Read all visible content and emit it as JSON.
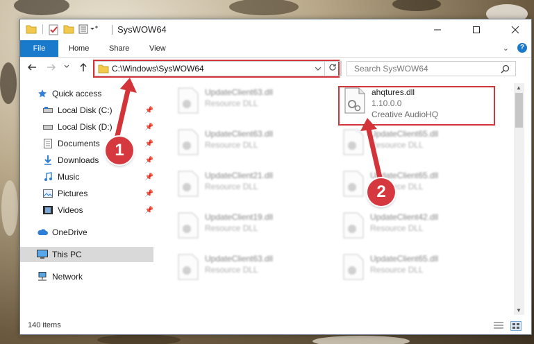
{
  "window": {
    "title": "SysWOW64"
  },
  "ribbon": {
    "tabs": [
      "File",
      "Home",
      "Share",
      "View"
    ]
  },
  "address_bar": {
    "path": "C:\\Windows\\SysWOW64"
  },
  "search": {
    "placeholder": "Search SysWOW64"
  },
  "sidebar": {
    "items": [
      {
        "label": "Quick access",
        "icon": "star-icon"
      },
      {
        "label": "Local Disk (C:)",
        "icon": "drive-icon",
        "pinned": true
      },
      {
        "label": "Local Disk (D:)",
        "icon": "drive-icon",
        "pinned": true
      },
      {
        "label": "Documents",
        "icon": "documents-icon",
        "pinned": true
      },
      {
        "label": "Downloads",
        "icon": "download-icon",
        "pinned": true
      },
      {
        "label": "Music",
        "icon": "music-icon",
        "pinned": true
      },
      {
        "label": "Pictures",
        "icon": "pictures-icon",
        "pinned": true
      },
      {
        "label": "Videos",
        "icon": "videos-icon",
        "pinned": true
      },
      {
        "label": "OneDrive",
        "icon": "cloud-icon"
      },
      {
        "label": "This PC",
        "icon": "monitor-icon",
        "selected": true
      },
      {
        "label": "Network",
        "icon": "network-icon"
      }
    ]
  },
  "files": {
    "left_column": [
      {
        "name": "UpdateClient63.dll",
        "type": "Resource DLL"
      },
      {
        "name": "UpdateClient63.dll",
        "type": "Resource DLL"
      },
      {
        "name": "UpdateClient21.dll",
        "type": "Resource DLL"
      },
      {
        "name": "UpdateClient19.dll",
        "type": "Resource DLL"
      },
      {
        "name": "UpdateClient63.dll",
        "type": "Resource DLL"
      }
    ],
    "highlighted": {
      "name": "ahqtures.dll",
      "version": "1.10.0.0",
      "company": "Creative AudioHQ"
    },
    "right_column": [
      {
        "name": "UpdateClient65.dll",
        "type": "Resource DLL"
      },
      {
        "name": "UpdateClient65.dll",
        "type": "Resource DLL"
      },
      {
        "name": "UpdateClient42.dll",
        "type": "Resource DLL"
      },
      {
        "name": "UpdateClient65.dll",
        "type": "Resource DLL"
      }
    ]
  },
  "status": {
    "item_count": "140 items"
  },
  "annotations": {
    "step1": "1",
    "step2": "2"
  },
  "colors": {
    "accent": "#1979ca",
    "highlight": "#d2343a"
  }
}
